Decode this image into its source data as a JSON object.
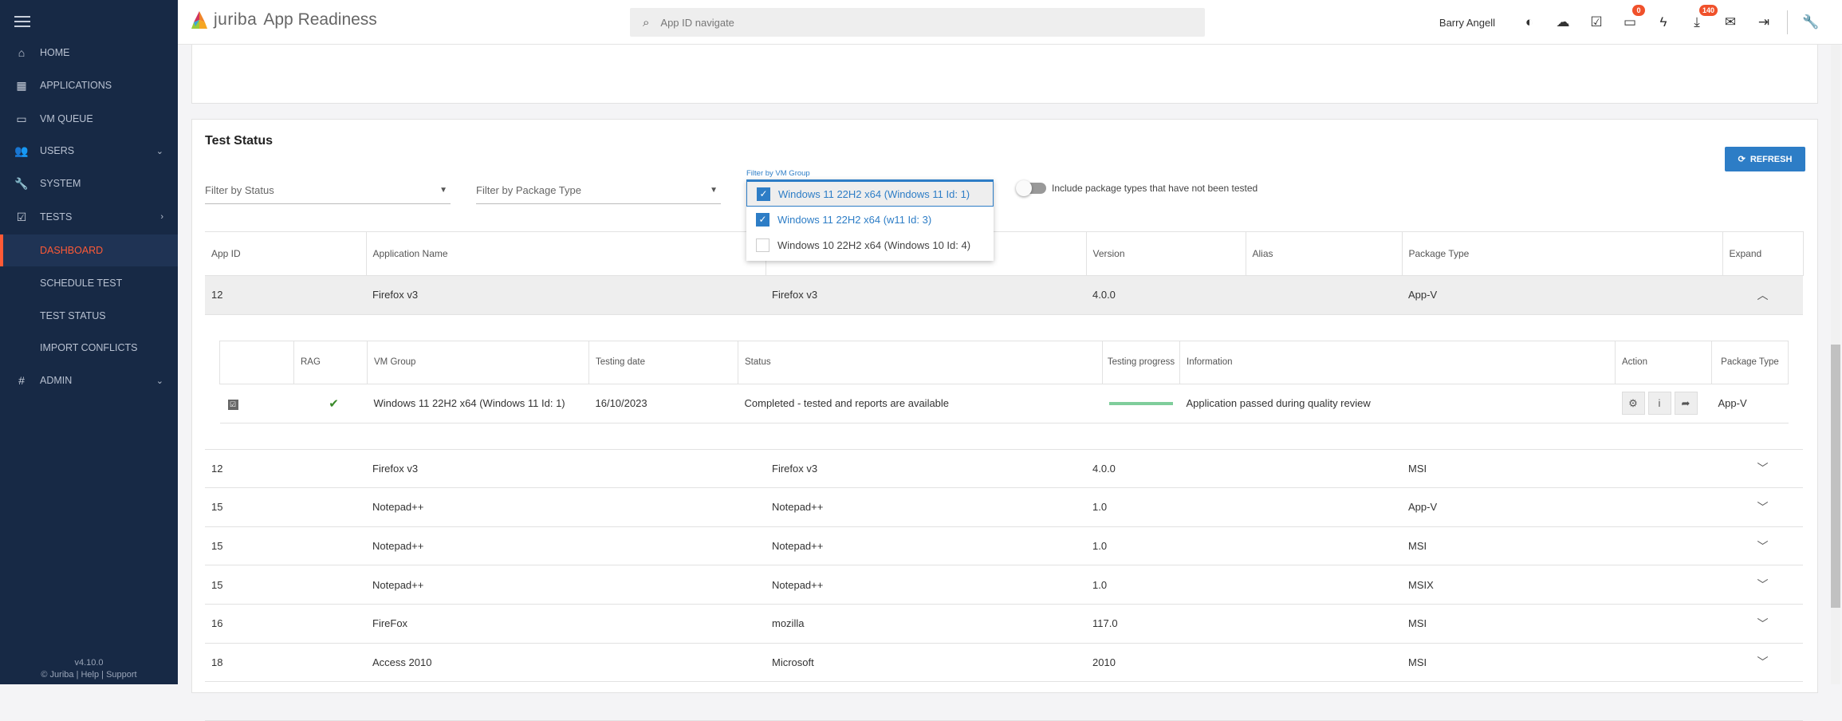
{
  "sidebar": {
    "items": [
      {
        "label": "HOME",
        "icon": "home-icon",
        "glyph": "⌂"
      },
      {
        "label": "APPLICATIONS",
        "icon": "grid-icon",
        "glyph": "▦"
      },
      {
        "label": "VM QUEUE",
        "icon": "monitor-icon",
        "glyph": "▭"
      },
      {
        "label": "USERS",
        "icon": "users-icon",
        "glyph": "👥",
        "chevron": "⌄"
      },
      {
        "label": "SYSTEM",
        "icon": "wrench-icon",
        "glyph": "🔧"
      },
      {
        "label": "TESTS",
        "icon": "tests-icon",
        "glyph": "☑",
        "chevron": "›"
      },
      {
        "label": "DASHBOARD",
        "sub": true,
        "active": true
      },
      {
        "label": "SCHEDULE TEST",
        "sub": true
      },
      {
        "label": "TEST STATUS",
        "sub": true
      },
      {
        "label": "IMPORT CONFLICTS",
        "sub": true
      },
      {
        "label": "ADMIN",
        "icon": "hash-icon",
        "glyph": "#",
        "chevron": "⌄"
      }
    ],
    "version": "v4.10.0",
    "footer": "© Juriba | Help | Support"
  },
  "header": {
    "brand": "juriba",
    "title": "App Readiness",
    "search_placeholder": "App ID navigate",
    "user": "Barry Angell",
    "monitor_badge": "0",
    "download_badge": "140"
  },
  "page": {
    "title": "Test Status",
    "refresh": "REFRESH",
    "filter_status": "Filter by Status",
    "filter_package": "Filter by Package Type",
    "filter_vm_label": "Filter by VM Group",
    "vm_options": [
      {
        "label": "Windows 11 22H2 x64 (Windows 11 Id: 1)",
        "checked": true
      },
      {
        "label": "Windows 11 22H2 x64 (w11 Id: 3)",
        "checked": true
      },
      {
        "label": "Windows 10 22H2 x64 (Windows 10 Id: 4)",
        "checked": false
      }
    ],
    "toggle_label": "Include package types that have not been tested"
  },
  "table": {
    "columns": [
      "App ID",
      "Application Name",
      "",
      "Version",
      "Alias",
      "Package Type",
      "Expand"
    ],
    "rows": [
      {
        "id": "12",
        "name": "Firefox v3",
        "vendor": "Firefox v3",
        "version": "4.0.0",
        "alias": "",
        "type": "App-V",
        "expanded": true
      },
      {
        "id": "12",
        "name": "Firefox v3",
        "vendor": "Firefox v3",
        "version": "4.0.0",
        "alias": "",
        "type": "MSI"
      },
      {
        "id": "15",
        "name": "Notepad++",
        "vendor": "Notepad++",
        "version": "1.0",
        "alias": "",
        "type": "App-V"
      },
      {
        "id": "15",
        "name": "Notepad++",
        "vendor": "Notepad++",
        "version": "1.0",
        "alias": "",
        "type": "MSI"
      },
      {
        "id": "15",
        "name": "Notepad++",
        "vendor": "Notepad++",
        "version": "1.0",
        "alias": "",
        "type": "MSIX"
      },
      {
        "id": "16",
        "name": "FireFox",
        "vendor": "mozilla",
        "version": "117.0",
        "alias": "",
        "type": "MSI"
      },
      {
        "id": "18",
        "name": "Access 2010",
        "vendor": "Microsoft",
        "version": "2010",
        "alias": "",
        "type": "MSI"
      }
    ]
  },
  "detail": {
    "columns": [
      "",
      "RAG",
      "VM Group",
      "Testing date",
      "Status",
      "Testing progress",
      "Information",
      "Action",
      "Package Type"
    ],
    "row": {
      "vm_group": "Windows 11 22H2 x64 (Windows 11 Id: 1)",
      "date": "16/10/2023",
      "status": "Completed - tested and reports are available",
      "progress": 100,
      "info": "Application passed during quality review",
      "type": "App-V"
    }
  },
  "colors": {
    "sidebar": "#172945",
    "accent": "#2d7dc6",
    "active": "#ff5a36",
    "progress": "#7fcd9b"
  }
}
